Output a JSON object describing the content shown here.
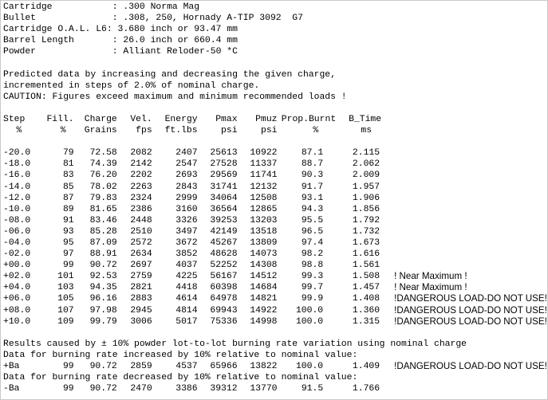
{
  "info": [
    {
      "label": "Cartridge           ",
      "value": ": .300 Norma Mag"
    },
    {
      "label": "Bullet              ",
      "value": ": .308, 250, Hornady A-TIP 3092  G7"
    },
    {
      "label": "Cartridge O.A.L. L6",
      "value": ": 3.680 inch or 93.47 mm"
    },
    {
      "label": "Barrel Length       ",
      "value": ": 26.0 inch or 660.4 mm"
    },
    {
      "label": "Powder              ",
      "value": ": Alliant Reloder-50 *C"
    }
  ],
  "notes": [
    "Predicted data by increasing and decreasing the given charge,",
    "incremented in steps of 2.0% of nominal charge.",
    "CAUTION: Figures exceed maximum and minimum recommended loads !"
  ],
  "headers": [
    "Step",
    "Fill.",
    "Charge",
    "Vel.",
    "Energy",
    "Pmax",
    "Pmuz",
    "Prop.Burnt",
    "B_Time"
  ],
  "units": [
    "%",
    "%",
    "Grains",
    "fps",
    "ft.lbs",
    "psi",
    "psi",
    "%",
    "ms"
  ],
  "rows": [
    [
      "-20.0",
      "79",
      "72.58",
      "2082",
      "2407",
      "25613",
      "10922",
      "87.1",
      "2.115",
      ""
    ],
    [
      "-18.0",
      "81",
      "74.39",
      "2142",
      "2547",
      "27528",
      "11337",
      "88.7",
      "2.062",
      ""
    ],
    [
      "-16.0",
      "83",
      "76.20",
      "2202",
      "2693",
      "29569",
      "11741",
      "90.3",
      "2.009",
      ""
    ],
    [
      "-14.0",
      "85",
      "78.02",
      "2263",
      "2843",
      "31741",
      "12132",
      "91.7",
      "1.957",
      ""
    ],
    [
      "-12.0",
      "87",
      "79.83",
      "2324",
      "2999",
      "34064",
      "12508",
      "93.1",
      "1.906",
      ""
    ],
    [
      "-10.0",
      "89",
      "81.65",
      "2386",
      "3160",
      "36564",
      "12865",
      "94.3",
      "1.856",
      ""
    ],
    [
      "-08.0",
      "91",
      "83.46",
      "2448",
      "3326",
      "39253",
      "13203",
      "95.5",
      "1.792",
      ""
    ],
    [
      "-06.0",
      "93",
      "85.28",
      "2510",
      "3497",
      "42149",
      "13518",
      "96.5",
      "1.732",
      ""
    ],
    [
      "-04.0",
      "95",
      "87.09",
      "2572",
      "3672",
      "45267",
      "13809",
      "97.4",
      "1.673",
      ""
    ],
    [
      "-02.0",
      "97",
      "88.91",
      "2634",
      "3852",
      "48628",
      "14073",
      "98.2",
      "1.616",
      ""
    ],
    [
      "+00.0",
      "99",
      "90.72",
      "2697",
      "4037",
      "52252",
      "14308",
      "98.8",
      "1.561",
      ""
    ],
    [
      "+02.0",
      "101",
      "92.53",
      "2759",
      "4225",
      "56167",
      "14512",
      "99.3",
      "1.508",
      "! Near Maximum !"
    ],
    [
      "+04.0",
      "103",
      "94.35",
      "2821",
      "4418",
      "60398",
      "14684",
      "99.7",
      "1.457",
      "! Near Maximum !"
    ],
    [
      "+06.0",
      "105",
      "96.16",
      "2883",
      "4614",
      "64978",
      "14821",
      "99.9",
      "1.408",
      "!DANGEROUS LOAD-DO NOT USE!"
    ],
    [
      "+08.0",
      "107",
      "97.98",
      "2945",
      "4814",
      "69943",
      "14922",
      "100.0",
      "1.360",
      "!DANGEROUS LOAD-DO NOT USE!"
    ],
    [
      "+10.0",
      "109",
      "99.79",
      "3006",
      "5017",
      "75336",
      "14998",
      "100.0",
      "1.315",
      "!DANGEROUS LOAD-DO NOT USE!"
    ]
  ],
  "variation": {
    "title": "Results caused by ± 10% powder lot-to-lot burning rate variation using nominal charge",
    "increased_label": "Data for burning rate increased by 10% relative to nominal value:",
    "increased_row": [
      "+Ba",
      "99",
      "90.72",
      "2859",
      "4537",
      "65966",
      "13822",
      "100.0",
      "1.409",
      "!DANGEROUS LOAD-DO NOT USE!"
    ],
    "decreased_label": "Data for burning rate decreased by 10% relative to nominal value:",
    "decreased_row": [
      "-Ba",
      "99",
      "90.72",
      "2470",
      "3386",
      "39312",
      "13770",
      "91.5",
      "1.766",
      ""
    ]
  }
}
